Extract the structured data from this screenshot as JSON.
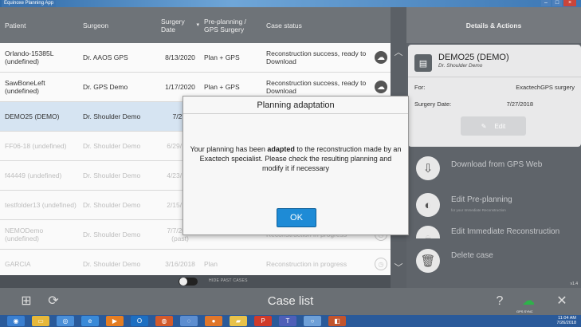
{
  "window": {
    "title": "Equinoxe Planning App",
    "controls": [
      "–",
      "□",
      "×"
    ]
  },
  "table": {
    "headers": {
      "patient": "Patient",
      "surgeon": "Surgeon",
      "date": "Surgery Date",
      "preplanning": "Pre-planning / GPS Surgery",
      "status": "Case status"
    },
    "rows": [
      {
        "patient": "Orlando-15385L (undefined)",
        "surgeon": "Dr. AAOS GPS",
        "date": "8/13/2020",
        "pre": "Plan + GPS",
        "status": "Reconstruction success, ready to Download",
        "icon": "cloud-download-icon",
        "faded": false
      },
      {
        "patient": "SawBoneLeft (undefined)",
        "surgeon": "Dr. GPS Demo",
        "date": "1/17/2020",
        "pre": "Plan + GPS",
        "status": "Reconstruction success, ready to Download",
        "icon": "cloud-download-icon",
        "faded": false
      },
      {
        "patient": "DEMO25 (DEMO)",
        "surgeon": "Dr. Shoulder Demo",
        "date": "7/27/",
        "pre": "",
        "status": "",
        "icon": "",
        "faded": false
      },
      {
        "patient": "FF06-18 (undefined)",
        "surgeon": "Dr. Shoulder Demo",
        "date": "6/29/ (pa",
        "pre": "",
        "status": "",
        "icon": "",
        "faded": true
      },
      {
        "patient": "f44449 (undefined)",
        "surgeon": "Dr. Shoulder Demo",
        "date": "4/23/ (pa",
        "pre": "",
        "status": "",
        "icon": "",
        "faded": true
      },
      {
        "patient": "testfolder13 (undefined)",
        "surgeon": "Dr. Shoulder Demo",
        "date": "2/15/ (pa",
        "pre": "",
        "status": "",
        "icon": "",
        "faded": true
      },
      {
        "patient": "NEMODemo (undefined)",
        "surgeon": "Dr. Shoulder Demo",
        "date": "7/7/2018 (past)",
        "pre": "",
        "status": "Reconstruction in progress",
        "icon": "clock-icon",
        "faded": true
      },
      {
        "patient": "GARCIA",
        "surgeon": "Dr. Shoulder Demo",
        "date": "3/16/2018",
        "pre": "Plan",
        "status": "Reconstruction in progress",
        "icon": "clock-icon",
        "faded": true
      }
    ],
    "hide_past_label": "HIDE PAST CASES"
  },
  "details": {
    "header": "Details & Actions",
    "case_title": "DEMO25 (DEMO)",
    "case_subtitle": "Dr. Shoulder Demo",
    "for_label": "For:",
    "for_value": "ExactechGPS surgery",
    "date_label": "Surgery Date:",
    "date_value": "7/27/2018",
    "edit_label": "Edit",
    "actions": [
      {
        "label": "Download from GPS Web",
        "sub": "",
        "icon": "cloud-download-icon"
      },
      {
        "label": "Edit Pre-planning",
        "sub": "for your Immediate Reconstruction",
        "icon": "planning-icon"
      },
      {
        "label": "Edit Immediate Reconstruction",
        "sub": "",
        "icon": "reconstruction-icon"
      },
      {
        "label": "Delete case",
        "sub": "",
        "icon": "trash-icon"
      }
    ],
    "version": "v1.4"
  },
  "bottom": {
    "title": "Case list",
    "sync_label": "GPS SYNC"
  },
  "dialog": {
    "title": "Planning adaptation",
    "msg_before": "Your planning has been ",
    "msg_bold": "adapted",
    "msg_after": " to the reconstruction made by an Exactech specialist. Please check the resulting planning and modify it if necessary",
    "ok_label": "OK"
  },
  "taskbar": {
    "time": "11:04 AM",
    "date": "7/26/2018",
    "apps": [
      "start-orb-icon",
      "file-explorer-icon",
      "chrome-icon",
      "ie-icon",
      "media-icon",
      "outlook-icon",
      "app-icon",
      "app2-icon",
      "firefox-icon",
      "folder-icon",
      "powerpoint-icon",
      "teams-icon",
      "search-icon",
      "app3-icon"
    ]
  }
}
